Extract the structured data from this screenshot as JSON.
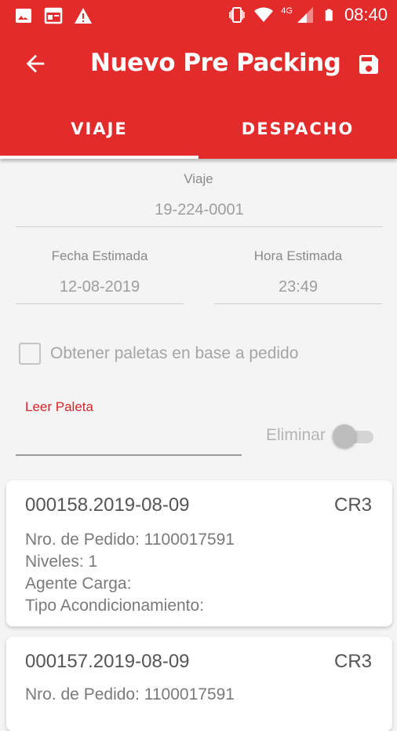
{
  "status_bar": {
    "time": "08:40",
    "network": "4G",
    "icons": [
      "image-icon",
      "calendar-icon",
      "warning-icon",
      "vibrate-icon",
      "wifi-icon",
      "signal-icon",
      "battery-icon"
    ]
  },
  "app_bar": {
    "title": "Nuevo Pre Packing",
    "back_icon": "arrow-back-icon",
    "save_icon": "save-icon"
  },
  "tabs": [
    {
      "label": "VIAJE",
      "selected": true
    },
    {
      "label": "DESPACHO",
      "selected": false
    }
  ],
  "form": {
    "viaje_label": "Viaje",
    "viaje_value": "19-224-0001",
    "fecha_label": "Fecha Estimada",
    "fecha_value": "12-08-2019",
    "hora_label": "Hora Estimada",
    "hora_value": "23:49",
    "checkbox_label": "Obtener paletas en base a pedido",
    "checkbox_checked": false,
    "leer_paleta_label": "Leer Paleta",
    "leer_paleta_value": "",
    "eliminar_label": "Eliminar",
    "eliminar_on": false
  },
  "cards": [
    {
      "id": "000158.2019-08-09",
      "code": "CR3",
      "pedido": "Nro. de Pedido: 1100017591",
      "niveles": "Niveles: 1",
      "agente": "Agente Carga:",
      "tipo": "Tipo Acondicionamiento:"
    },
    {
      "id": "000157.2019-08-09",
      "code": "CR3",
      "pedido": "Nro. de Pedido: 1100017591"
    }
  ],
  "colors": {
    "primary": "#e32b2b",
    "accent_text": "#d8262a",
    "background": "#f4f4f4"
  }
}
